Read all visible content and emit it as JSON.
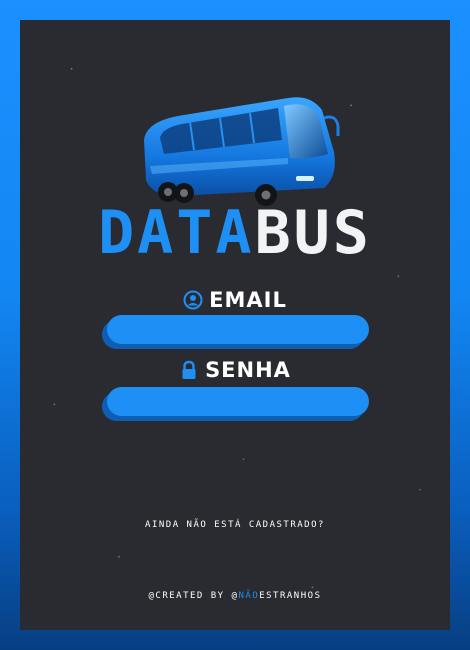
{
  "logo": {
    "part1": "DATA",
    "part2": "BUS",
    "colors": {
      "part1": "#1d8ff5",
      "part2": "#f2f3f5"
    }
  },
  "form": {
    "email_label": "EMAIL",
    "email_icon": "user-circle-icon",
    "email_value": "",
    "senha_label": "SENHA",
    "senha_icon": "lock-icon",
    "senha_value": ""
  },
  "signup_link": "AINDA NÃO ESTÁ CADASTRADO?",
  "credit": {
    "prefix": "@CREATED BY @",
    "highlight": "NÃO",
    "suffix": "ESTRANHOS"
  },
  "colors": {
    "accent": "#1d8ff5",
    "panel": "#2a2b30",
    "frame": "#1b90ff"
  }
}
